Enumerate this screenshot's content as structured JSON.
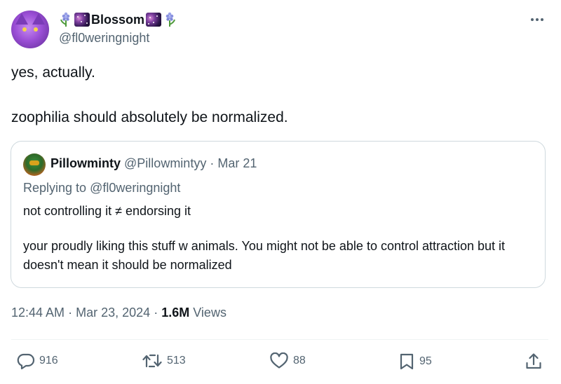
{
  "author": {
    "display_name": "Blossom",
    "handle": "@fl0weringnight"
  },
  "tweet": {
    "text": "yes, actually.\n\nzoophilia should absolutely be normalized."
  },
  "quoted": {
    "display_name": "Pillowminty",
    "handle": "@Pillowmintyy",
    "dot": "·",
    "date": "Mar 21",
    "replying_prefix": "Replying to",
    "replying_handle": "@fl0weringnight",
    "paragraphs": [
      "not controlling it ≠ endorsing it",
      "your proudly liking this stuff w animals. You might not be able to control attraction but it doesn't mean it should be normalized"
    ]
  },
  "meta": {
    "time": "12:44 AM",
    "dot": "·",
    "date": "Mar 23, 2024",
    "views_count": "1.6M",
    "views_label": "Views"
  },
  "actions": {
    "replies": "916",
    "reposts": "513",
    "likes": "88",
    "bookmarks": "95"
  },
  "icons": {
    "more": "more-horizontal-icon",
    "reply": "reply-bubble-icon",
    "repost": "repost-icon",
    "like": "heart-icon",
    "bookmark": "bookmark-icon",
    "share": "share-upload-icon",
    "emoji_left": "hyacinth-emoji",
    "emoji_galaxy": "milky-way-emoji"
  },
  "colors": {
    "text": "#0f1419",
    "secondary": "#536471",
    "border": "#cfd9de"
  }
}
